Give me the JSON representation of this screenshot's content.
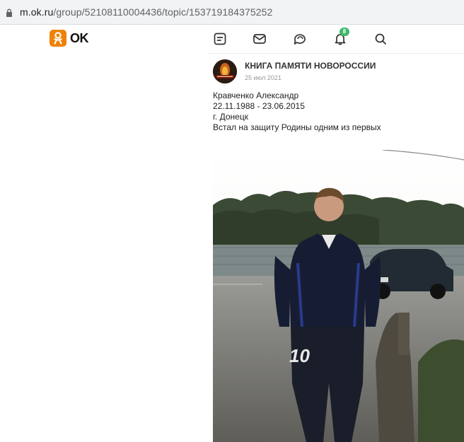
{
  "browser": {
    "url_host": "m.ok.ru",
    "url_path": "/group/52108110004436/topic/153719184375252"
  },
  "header": {
    "logo_text": "OK",
    "notification_count": "8",
    "icons": [
      "feed-icon",
      "messages-icon",
      "discussions-icon",
      "notifications-icon",
      "search-icon"
    ]
  },
  "post": {
    "group_name": "КНИГА ПАМЯТИ НОВОРОССИИ",
    "date": "25 июл 2021",
    "lines": [
      "Кравченко Александр",
      "22.11.1988 - 23.06.2015",
      "г. Донецк",
      "Встал на защиту Родины одним из первых"
    ],
    "photo_jersey_number": "10"
  },
  "colors": {
    "ok_orange": "#ee8208",
    "badge_green": "#3fb96a"
  }
}
